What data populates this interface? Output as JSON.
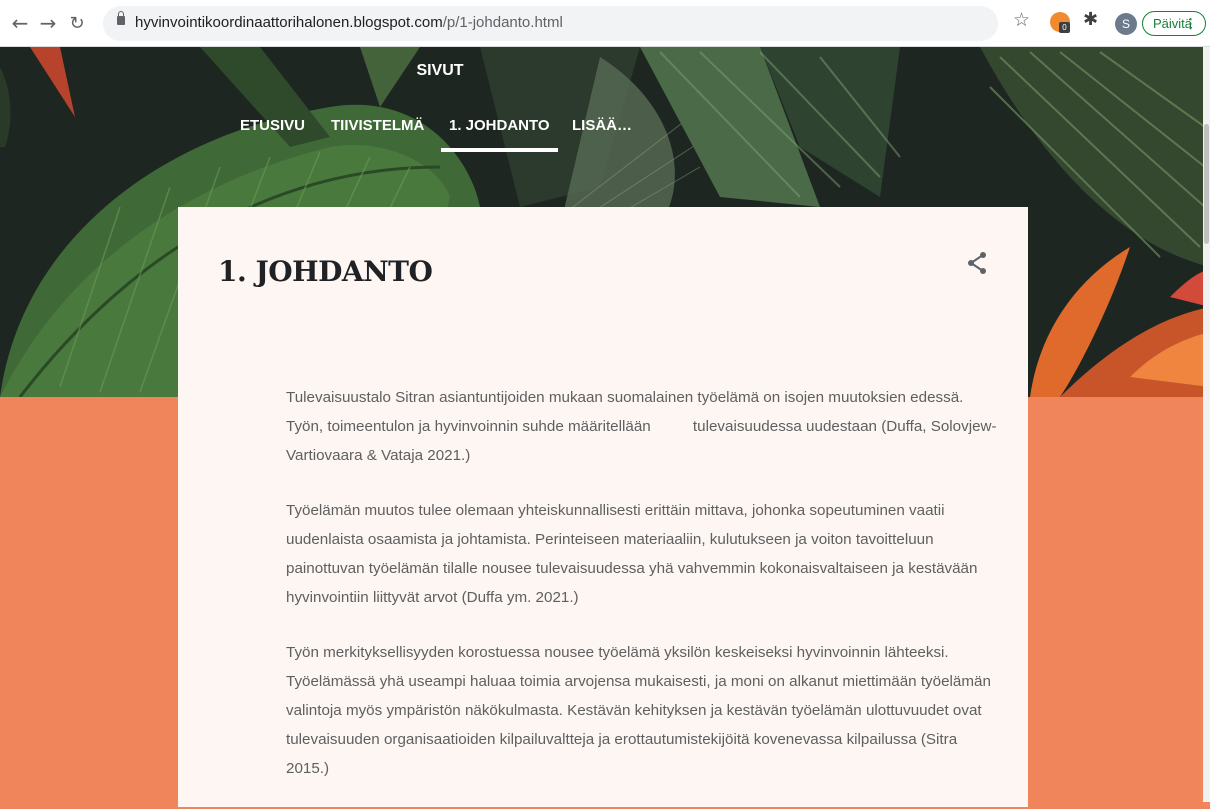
{
  "browser": {
    "back_icon": "arrow-left-icon",
    "forward_icon": "arrow-right-icon",
    "reload_icon": "reload-icon",
    "url_host": "hyvinvointikoordinaattorihalonen.blogspot.com",
    "url_path": "/p/1-johdanto.html",
    "avatar_letter": "S",
    "extension_badge": "0",
    "update_label": "Päivitä",
    "update_menu": "⋮"
  },
  "header": {
    "section_label": "SIVUT",
    "tabs": [
      {
        "label": "ETUSIVU",
        "active": false
      },
      {
        "label": "TIIVISTELMÄ",
        "active": false
      },
      {
        "label": "1. JOHDANTO",
        "active": true
      },
      {
        "label": "LISÄÄ…",
        "active": false
      }
    ]
  },
  "post": {
    "title": "1. JOHDANTO",
    "paragraphs": [
      "Tulevaisuustalo Sitran asiantuntijoiden mukaan suomalainen työelämä on isojen muutoksien edessä. Työn, toimeentulon ja hyvinvoinnin suhde määritellään          tulevaisuudessa uudestaan (Duffa, Solovjew-Vartiovaara & Vataja 2021.)",
      "Työelämän muutos tulee olemaan yhteiskunnallisesti erittäin mittava, johonka sopeutuminen vaatii uudenlaista osaamista ja johtamista. Perinteiseen materiaaliin, kulutukseen ja voiton tavoitteluun painottuvan työelämän tilalle nousee tulevaisuudessa yhä vahvemmin kokonaisvaltaiseen ja kestävään hyvinvointiin liittyvät arvot (Duffa ym. 2021.)",
      "Työn merkityksellisyyden korostuessa nousee työelämä yksilön keskeiseksi hyvinvoinnin lähteeksi. Työelämässä yhä useampi haluaa toimia arvojensa mukaisesti, ja moni on alkanut miettimään työelämän valintoja myös ympäristön näkökulmasta. Kestävän kehityksen ja kestävän työelämän ulottuvuudet ovat tulevaisuuden organisaatioiden kilpailuvaltteja ja erottautumistekijöitä kovenevassa kilpailussa (Sitra 2015.)"
    ]
  },
  "colors": {
    "accent_orange": "#f0855b",
    "card_bg": "#fdf6f3",
    "update_green": "#188038"
  }
}
